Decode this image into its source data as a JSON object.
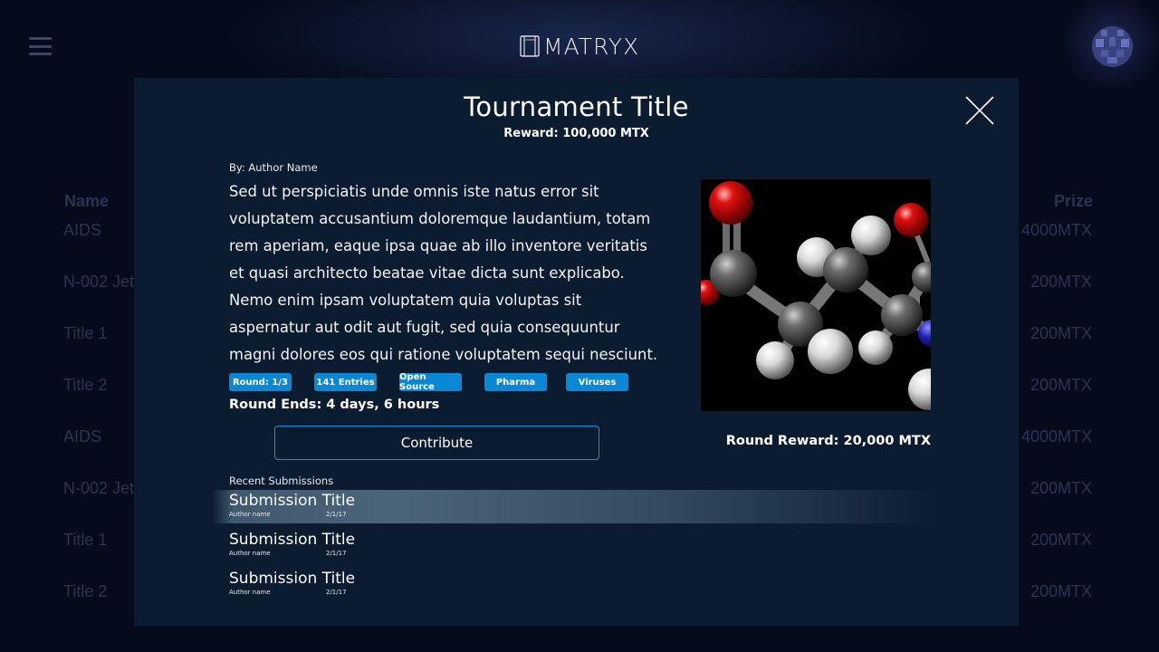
{
  "header": {
    "logo_text": "MATRYX",
    "menu_icon": "hamburger-menu-icon",
    "avatar_icon": "user-avatar-icon"
  },
  "background_table": {
    "columns": {
      "name": "Name",
      "prize": "Prize"
    },
    "rows": [
      {
        "name": "AIDS",
        "prize": "4000MTX"
      },
      {
        "name": "N-002 Jet",
        "prize": "200MTX"
      },
      {
        "name": "Title 1",
        "prize": "200MTX"
      },
      {
        "name": "Title 2",
        "prize": "200MTX"
      },
      {
        "name": "AIDS",
        "prize": "4000MTX"
      },
      {
        "name": "N-002 Jet",
        "prize": "200MTX"
      },
      {
        "name": "Title 1",
        "prize": "200MTX"
      },
      {
        "name": "Title 2",
        "prize": "200MTX"
      }
    ]
  },
  "modal": {
    "title": "Tournament Title",
    "reward": "Reward: 100,000 MTX",
    "author": "By: Author Name",
    "description": "Sed ut perspiciatis unde omnis iste natus error sit voluptatem accusantium doloremque laudantium, totam rem aperiam, eaque ipsa quae ab illo inventore veritatis et quasi architecto beatae vitae dicta sunt explicabo. Nemo enim ipsam voluptatem quia voluptas sit aspernatur aut odit aut fugit, sed quia consequuntur magni dolores eos qui ratione voluptatem sequi nesciunt.",
    "tags": [
      "Round: 1/3",
      "141 Entries",
      "Open Source",
      "Pharma",
      "Viruses"
    ],
    "round_ends": "Round Ends: 4 days, 6 hours",
    "contribute_label": "Contribute",
    "round_reward": "Round Reward: 20,000 MTX",
    "recent_label": "Recent Submissions",
    "submissions": [
      {
        "title": "Submission Title",
        "author": "Author name",
        "date": "2/1/17"
      },
      {
        "title": "Submission Title",
        "author": "Author name",
        "date": "2/1/17"
      },
      {
        "title": "Submission Title",
        "author": "Author name",
        "date": "2/1/17"
      }
    ],
    "image": "molecule-ball-and-stick-image",
    "colors": {
      "accent": "#0a88d6",
      "modal_bg": "#0c1c30",
      "page_bg": "#050b1c"
    }
  }
}
